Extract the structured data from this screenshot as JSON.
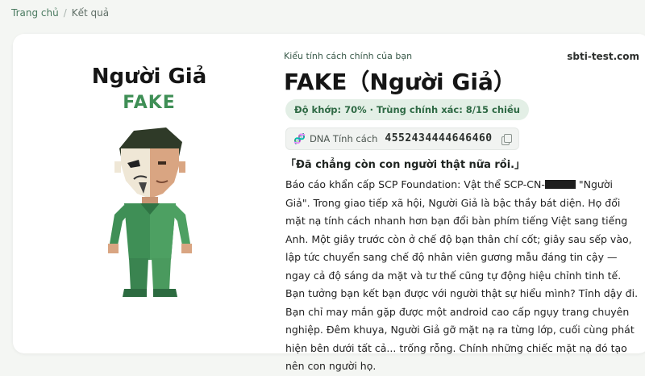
{
  "breadcrumb": {
    "home": "Trang chủ",
    "separator": "/",
    "current": "Kết quả"
  },
  "character": {
    "name": "Người Giả",
    "code": "FAKE"
  },
  "result": {
    "type_label": "Kiểu tính cách chính của bạn",
    "site": "sbti-test.com",
    "title": "FAKE（Người Giả）",
    "match": "Độ khớp: 70% · Trùng chính xác: 8/15 chiều",
    "dna_label": "DNA Tính cách",
    "dna_value": "4552434444646460",
    "quote": "「Đã chẳng còn con người thật nữa rồi.」",
    "desc_part1": "Báo cáo khẩn cấp SCP Foundation: Vật thể SCP-CN-",
    "desc_part2": " \"Người Giả\". Trong giao tiếp xã hội, Người Giả là bậc thầy bát diện. Họ đổi mặt nạ tính cách nhanh hơn bạn đổi bàn phím tiếng Việt sang tiếng Anh. Một giây trước còn ở chế độ bạn thân chí cốt; giây sau sếp vào, lập tức chuyển sang chế độ nhân viên gương mẫu đáng tin cậy — ngay cả độ sáng da mặt và tư thế cũng tự động hiệu chỉnh tinh tế. Bạn tưởng bạn kết bạn được với người thật sự hiểu mình? Tỉnh dậy đi. Bạn chỉ may mắn gặp được một android cao cấp ngụy trang chuyên nghiệp. Đêm khuya, Người Giả gỡ mặt nạ ra từng lớp, cuối cùng phát hiện bên dưới tất cả... trống rỗng. Chính những chiếc mặt nạ đó tạo nên con người họ."
  },
  "colors": {
    "accent_green": "#3f8f56",
    "badge_bg": "#e3efe6",
    "page_bg": "#f4f6f3"
  },
  "icons": {
    "dna": "dna-icon",
    "copy": "copy-icon"
  }
}
